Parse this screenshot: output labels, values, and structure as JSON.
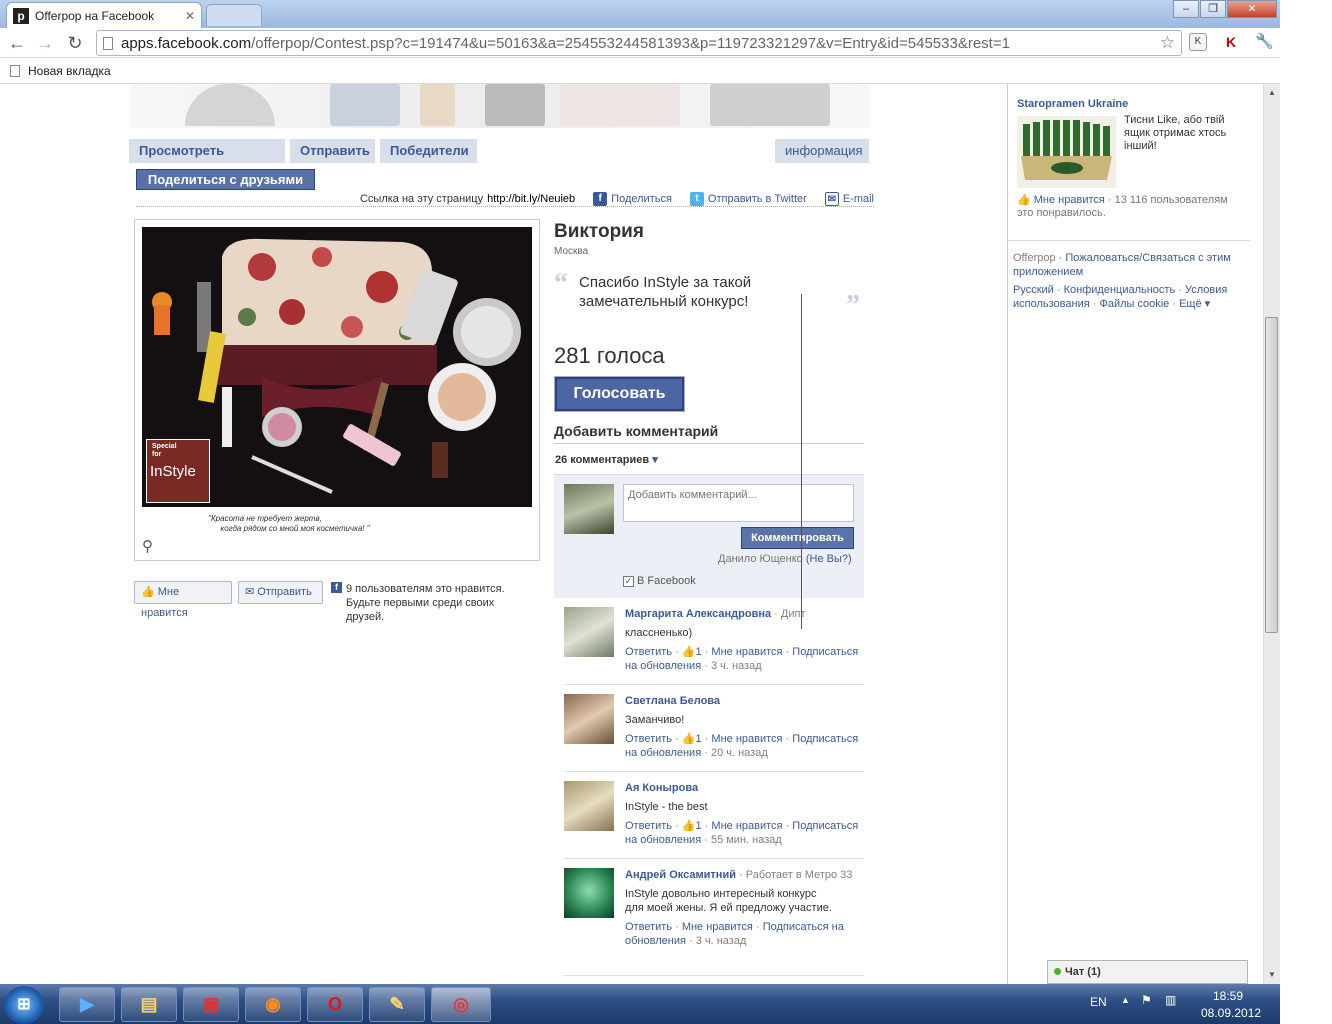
{
  "browser": {
    "tab_title": "Offerpop на Facebook",
    "tab_icon_letter": "p",
    "url_domain": "apps.facebook.com",
    "url_rest": "/offerpop/Contest.psp?c=191474&u=50163&a=254553244581393&p=119723321297&v=Entry&id=545533&rest=1",
    "bookmark_new_tab": "Новая вкладка"
  },
  "app": {
    "tabs": [
      "Просмотреть работы",
      "Отправить",
      "Победители"
    ],
    "info_tab": "информация",
    "share_button": "Поделиться с друзьями",
    "page_link_label": "Ссылка на эту страницу",
    "page_link_url": "http://bit.ly/Neuieb",
    "share_fb": "Поделиться",
    "share_twitter": "Отправить в Twitter",
    "share_email": "E-mail"
  },
  "photo": {
    "badge_line1": "Special",
    "badge_line2": "for",
    "badge_brand": "InStyle",
    "caption_line1": "\"Красота не требует жертв,",
    "caption_line2": "когда рядом со мной моя косметичка! \""
  },
  "photo_actions": {
    "like_button": "Мне нравится",
    "send_button": "Отправить",
    "like_text": "9 пользователям это нравится. Будьте первыми среди своих друзей."
  },
  "entry": {
    "name": "Виктория",
    "city": "Москва",
    "quote": "Спасибо InStyle за такой замечательный конкурс!",
    "votes": "281 голоса",
    "vote_button": "Голосовать"
  },
  "comments_widget": {
    "header": "Добавить комментарий",
    "count": "26 комментариев",
    "input_placeholder": "Добавить комментарий...",
    "submit_button": "Комментировать",
    "poster_name": "Данило Ющенко",
    "poster_not_you": "(Не Вы?)",
    "post_to_fb": "В Facebook"
  },
  "comments": [
    {
      "name": "Маргарита Александровна",
      "meta": "· Дипт",
      "text": "классненько)",
      "reply": "Ответить",
      "likes": "1",
      "like": "Мне нравится",
      "subscribe": "Подписаться на обновления",
      "time": "3 ч. назад"
    },
    {
      "name": "Светлана Белова",
      "meta": "",
      "text": "Заманчиво!",
      "reply": "Ответить",
      "likes": "1",
      "like": "Мне нравится",
      "subscribe": "Подписаться на обновления",
      "time": "20 ч. назад"
    },
    {
      "name": "Ая Конырова",
      "meta": "",
      "text": "InStyle - the best",
      "reply": "Ответить",
      "likes": "1",
      "like": "Мне нравится",
      "subscribe": "Подписаться на обновления",
      "time": "55 мин. назад"
    },
    {
      "name": "Андрей Оксамитний",
      "meta": "· Работает в Метро 33",
      "text": "InStyle довольно интересный конкурс для моей жены. Я ей предложу участие.",
      "reply": "Ответить",
      "likes": "",
      "like": "Мне нравится",
      "subscribe": "Подписаться на обновления",
      "time": "3 ч. назад"
    }
  ],
  "sidebar": {
    "ad_title": "Staropramen Ukraine",
    "ad_text": "Тисни Like, або твій ящик отримає хтось інший!",
    "ad_like": "Мне нравится",
    "ad_like_count": "· 13 116 пользователям это понравилось.",
    "footer_offerpop": "Offerpop",
    "footer_report": "Пожаловаться/Связаться с этим приложением",
    "footer_lang": "Русский",
    "footer_privacy": "Конфиденциальность",
    "footer_terms": "Условия использования",
    "footer_cookies": "Файлы cookie",
    "footer_more": "Ещё",
    "chat": "Чат (1)"
  },
  "taskbar": {
    "lang": "EN",
    "time": "18:59",
    "date": "08.09.2012"
  },
  "colors": {
    "fb_blue": "#3b5998",
    "button_blue": "#4c66a4",
    "tab_bg": "#d8dfea"
  }
}
